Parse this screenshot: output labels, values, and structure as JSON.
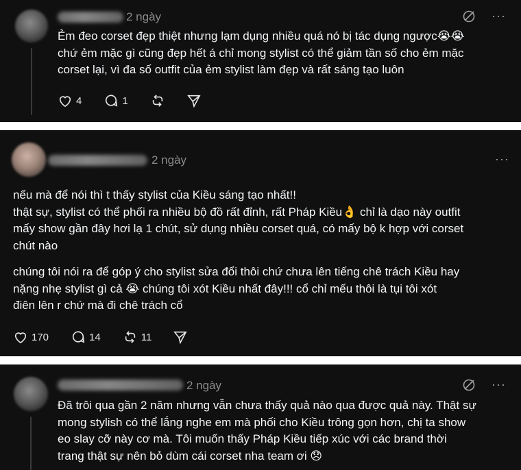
{
  "comments": [
    {
      "time": "2 ngày",
      "more": "···",
      "lines": [
        "Ẻm đeo corset đẹp thiệt nhưng lạm dụng nhiều quá nó bị tác dụng ngược😭😭",
        "chứ ẻm mặc gì cũng đẹp hết á chỉ mong stylist có thể giảm tần số cho ẻm mặc",
        "corset lại, vì đa số outfit của ẻm stylist làm đẹp và rất sáng tạo luôn"
      ],
      "likes": "4",
      "replies": "1",
      "reposts": "",
      "icons": {
        "mute": "mute-icon",
        "like": "heart-icon",
        "reply": "comment-icon",
        "repost": "repost-icon",
        "share": "share-icon"
      }
    },
    {
      "time": "2 ngày",
      "more": "···",
      "paragraph1": [
        "nếu mà để nói thì t thấy stylist của Kiều sáng tạo nhất!!",
        "thật sự, stylist có thể phối ra nhiều bộ đồ rất đỉnh, rất Pháp Kiều👌 chỉ là dạo này outfit",
        "mấy show gần đây hơi lạ 1 chút, sử dụng nhiều corset quá, có mấy bộ k hợp với corset",
        "chút nào"
      ],
      "paragraph2": [
        "chúng tôi nói ra để góp ý cho stylist sửa đổi thôi chứ chưa lên tiếng chê trách Kiều hay",
        "nặng nhẹ stylist gì cả 😭 chúng tôi xót Kiều nhất đây!!! cổ chỉ mếu thôi là tụi tôi xót",
        "điên lên r chứ mà đi chê trách cổ"
      ],
      "likes": "170",
      "replies": "14",
      "reposts": "11"
    },
    {
      "time": "2 ngày",
      "more": "···",
      "lines": [
        "Đã trôi qua gần 2 năm nhưng vẫn chưa thấy quả nào qua được quả này. Thật sự",
        "mong stylish có thể lắng nghe em mà phối cho Kiều trông gọn hơn, chị ta show",
        "eo slay cỡ này cơ mà. Tôi muốn thấy Pháp Kiều tiếp xúc với các brand thời",
        "trang thật sự nên bỏ dùm cái corset nha team ơi 😞"
      ]
    }
  ]
}
